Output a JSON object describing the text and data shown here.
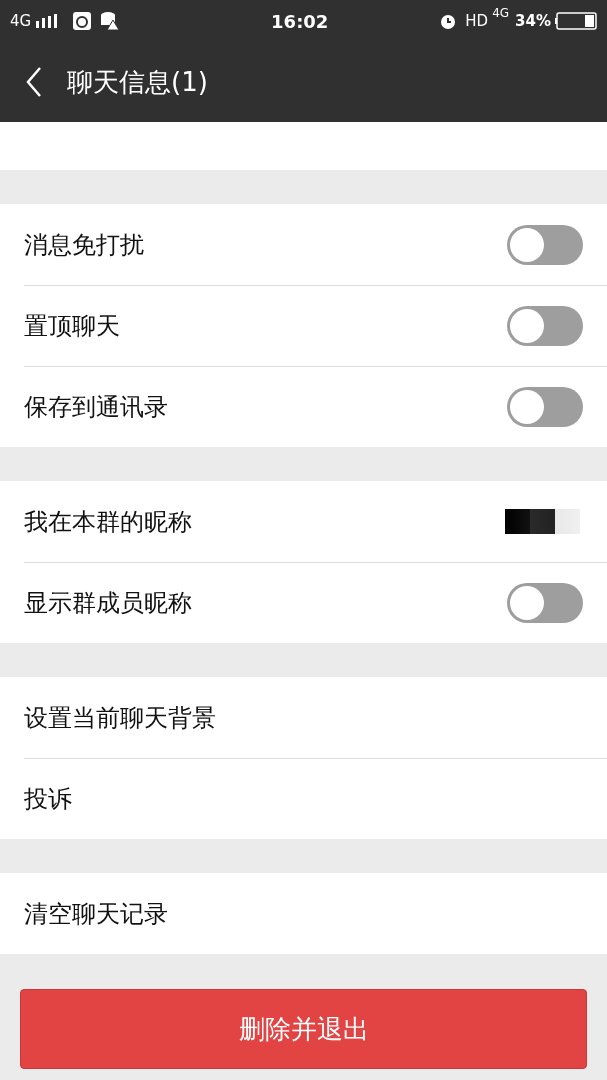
{
  "status_bar": {
    "network": "4G",
    "time": "16:02",
    "hd": "HD",
    "network_right": "4G",
    "battery_percent": "34%"
  },
  "header": {
    "title": "聊天信息(1)"
  },
  "groups": [
    {
      "items": [
        {
          "kind": "toggle",
          "label": "消息免打扰",
          "on": false
        },
        {
          "kind": "toggle",
          "label": "置顶聊天",
          "on": false
        },
        {
          "kind": "toggle",
          "label": "保存到通讯录",
          "on": false
        }
      ]
    },
    {
      "items": [
        {
          "kind": "value",
          "label": "我在本群的昵称"
        },
        {
          "kind": "toggle",
          "label": "显示群成员昵称",
          "on": false
        }
      ]
    },
    {
      "items": [
        {
          "kind": "link",
          "label": "设置当前聊天背景"
        },
        {
          "kind": "link",
          "label": "投诉"
        }
      ]
    },
    {
      "items": [
        {
          "kind": "link",
          "label": "清空聊天记录"
        }
      ]
    }
  ],
  "exit_button": "删除并退出"
}
